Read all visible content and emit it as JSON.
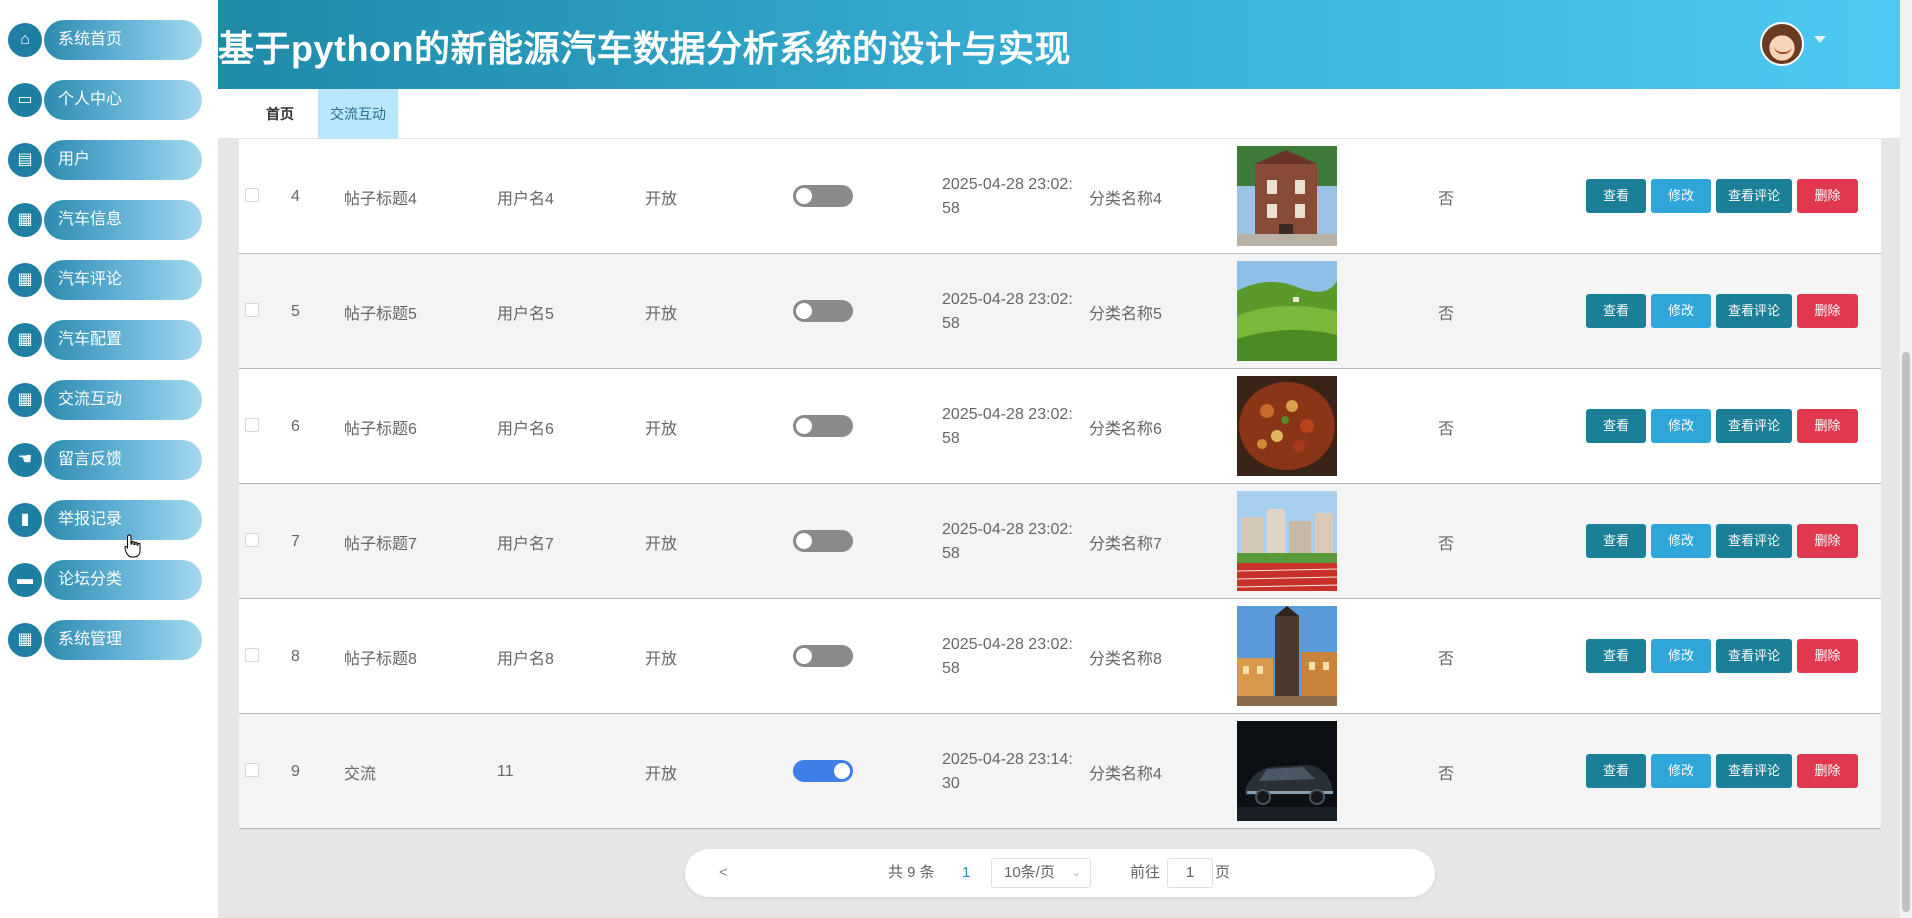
{
  "sidebar": {
    "items": [
      {
        "label": "系统首页",
        "icon": "home-icon",
        "glyph": "⌂"
      },
      {
        "label": "个人中心",
        "icon": "panel-icon",
        "glyph": "▭"
      },
      {
        "label": "用户",
        "icon": "briefcase-icon",
        "glyph": "▤"
      },
      {
        "label": "汽车信息",
        "icon": "grid-icon",
        "glyph": "▦"
      },
      {
        "label": "汽车评论",
        "icon": "grid-icon",
        "glyph": "▦"
      },
      {
        "label": "汽车配置",
        "icon": "grid-icon",
        "glyph": "▦"
      },
      {
        "label": "交流互动",
        "icon": "grid-icon",
        "glyph": "▦"
      },
      {
        "label": "留言反馈",
        "icon": "hand-icon",
        "glyph": "☚"
      },
      {
        "label": "举报记录",
        "icon": "clipboard-icon",
        "glyph": "▮"
      },
      {
        "label": "论坛分类",
        "icon": "ticket-icon",
        "glyph": "▬"
      },
      {
        "label": "系统管理",
        "icon": "grid-icon",
        "glyph": "▦"
      }
    ]
  },
  "header": {
    "title": "基于python的新能源汽车数据分析系统的设计与实现"
  },
  "tabs": [
    {
      "label": "首页"
    },
    {
      "label": "交流互动"
    }
  ],
  "table": {
    "rows": [
      {
        "idx": "4",
        "title": "帖子标题4",
        "user": "用户名4",
        "status": "开放",
        "switch_on": false,
        "time_line1": "2025-04-28 23:02:",
        "time_line2": "58",
        "category": "分类名称4",
        "image": "building-photo",
        "flag": "否"
      },
      {
        "idx": "5",
        "title": "帖子标题5",
        "user": "用户名5",
        "status": "开放",
        "switch_on": false,
        "time_line1": "2025-04-28 23:02:",
        "time_line2": "58",
        "category": "分类名称5",
        "image": "hills-photo",
        "flag": "否"
      },
      {
        "idx": "6",
        "title": "帖子标题6",
        "user": "用户名6",
        "status": "开放",
        "switch_on": false,
        "time_line1": "2025-04-28 23:02:",
        "time_line2": "58",
        "category": "分类名称6",
        "image": "food-photo",
        "flag": "否"
      },
      {
        "idx": "7",
        "title": "帖子标题7",
        "user": "用户名7",
        "status": "开放",
        "switch_on": false,
        "time_line1": "2025-04-28 23:02:",
        "time_line2": "58",
        "category": "分类名称7",
        "image": "track-photo",
        "flag": "否"
      },
      {
        "idx": "8",
        "title": "帖子标题8",
        "user": "用户名8",
        "status": "开放",
        "switch_on": false,
        "time_line1": "2025-04-28 23:02:",
        "time_line2": "58",
        "category": "分类名称8",
        "image": "tower-photo",
        "flag": "否"
      },
      {
        "idx": "9",
        "title": "交流",
        "user": "11",
        "status": "开放",
        "switch_on": true,
        "time_line1": "2025-04-28 23:14:",
        "time_line2": "30",
        "category": "分类名称4",
        "image": "car-photo",
        "flag": "否"
      }
    ],
    "actions": {
      "view": "查看",
      "edit": "修改",
      "comments": "查看评论",
      "delete": "删除"
    }
  },
  "pagination": {
    "prev": "<",
    "total": "共 9 条",
    "current": "1",
    "page_size": "10条/页",
    "goto": "前往",
    "goto_value": "1",
    "page_suffix": "页"
  },
  "colors": {
    "header_start": "#1e8aa8",
    "header_end": "#4ec9f2",
    "view_button": "#1b7f98",
    "edit_button": "#2ea6d9",
    "delete_button": "#e0394f",
    "switch_on": "#3f7fe8"
  }
}
